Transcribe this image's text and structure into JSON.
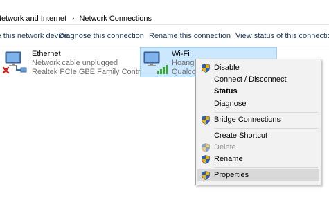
{
  "breadcrumb": {
    "parent": "Network and Internet",
    "current": "Network Connections",
    "separator": "›"
  },
  "toolbar": {
    "items": [
      "Disable this network device",
      "Diagnose this connection",
      "Rename this connection",
      "View status of this connection"
    ]
  },
  "connections": [
    {
      "name": "Ethernet",
      "status": "Network cable unplugged",
      "adapter": "Realtek PCIe GBE Family Controller",
      "icon": "ethernet-disconnected-icon"
    },
    {
      "name": "Wi-Fi",
      "status": "Hoang Le",
      "adapter": "Qualcomm",
      "icon": "wifi-adapter-icon",
      "selected": true
    }
  ],
  "context_menu": {
    "items": [
      {
        "label": "Disable",
        "shield": true
      },
      {
        "label": "Connect / Disconnect",
        "shield": false
      },
      {
        "label": "Status",
        "shield": false,
        "bold": true
      },
      {
        "label": "Diagnose",
        "shield": false
      },
      {
        "label": "Bridge Connections",
        "shield": true
      },
      {
        "label": "Create Shortcut",
        "shield": false
      },
      {
        "label": "Delete",
        "shield": true,
        "disabled": true
      },
      {
        "label": "Rename",
        "shield": true
      },
      {
        "label": "Properties",
        "shield": true,
        "highlighted": true
      }
    ]
  },
  "colors": {
    "selection_bg": "#cce8ff",
    "selection_border": "#99d1ff",
    "command_text": "#1e395b",
    "menu_bg": "#f2f2f2",
    "menu_hover": "#d9d9d9",
    "disabled_text": "#8d8d8d"
  }
}
